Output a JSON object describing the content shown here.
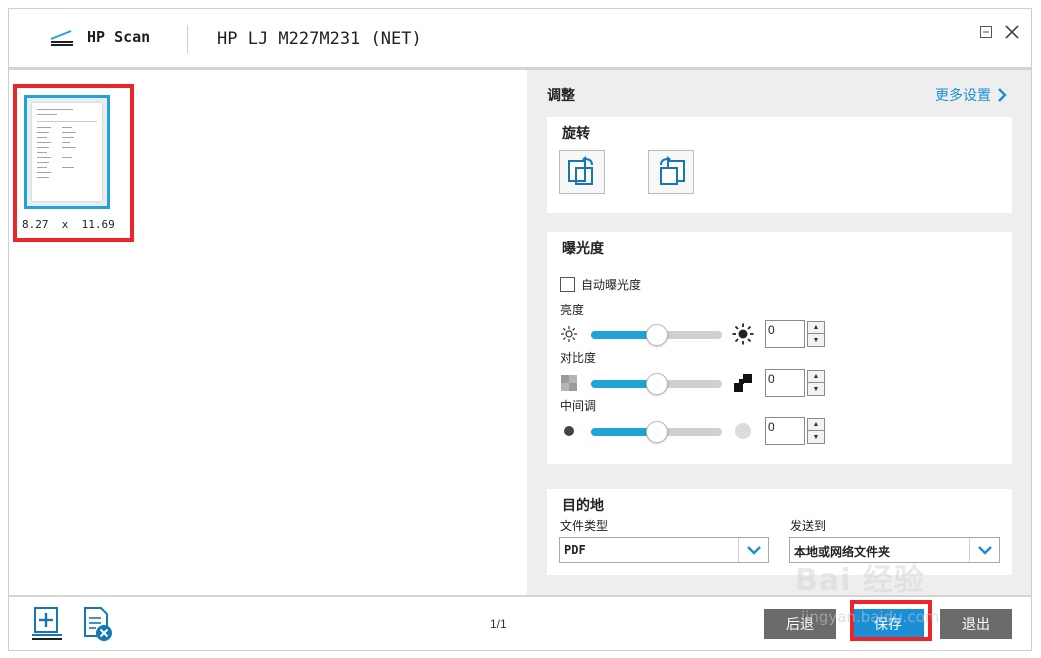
{
  "header": {
    "app_name": "HP Scan",
    "device_name": "HP LJ M227M231 (NET)",
    "minimize_label": "⊟",
    "close_label": "✕"
  },
  "preview": {
    "thumbnail_size": "8.27  x  11.69"
  },
  "panel": {
    "adjust_title": "调整",
    "more_settings": "更多设置",
    "rotate": {
      "title": "旋转"
    },
    "exposure": {
      "title": "曝光度",
      "auto_exposure_label": "自动曝光度",
      "auto_exposure_checked": false,
      "sliders": [
        {
          "label": "亮度",
          "value": "0",
          "position": 0.5
        },
        {
          "label": "对比度",
          "value": "0",
          "position": 0.5
        },
        {
          "label": "中间调",
          "value": "0",
          "position": 0.5
        }
      ]
    },
    "destination": {
      "title": "目的地",
      "file_type_label": "文件类型",
      "file_type_value": "PDF",
      "send_to_label": "发送到",
      "send_to_value": "本地或网络文件夹"
    }
  },
  "footer": {
    "page_counter": "1/1",
    "back_label": "后退",
    "save_label": "保存",
    "exit_label": "退出"
  },
  "watermark": {
    "top": "Bai  经验",
    "bottom": "jingyan.baidu.com"
  },
  "colors": {
    "accent": "#1fa3d8",
    "highlight": "#e8262b",
    "panel_bg": "#eeeeee",
    "button_gray": "#6b6b6b"
  }
}
